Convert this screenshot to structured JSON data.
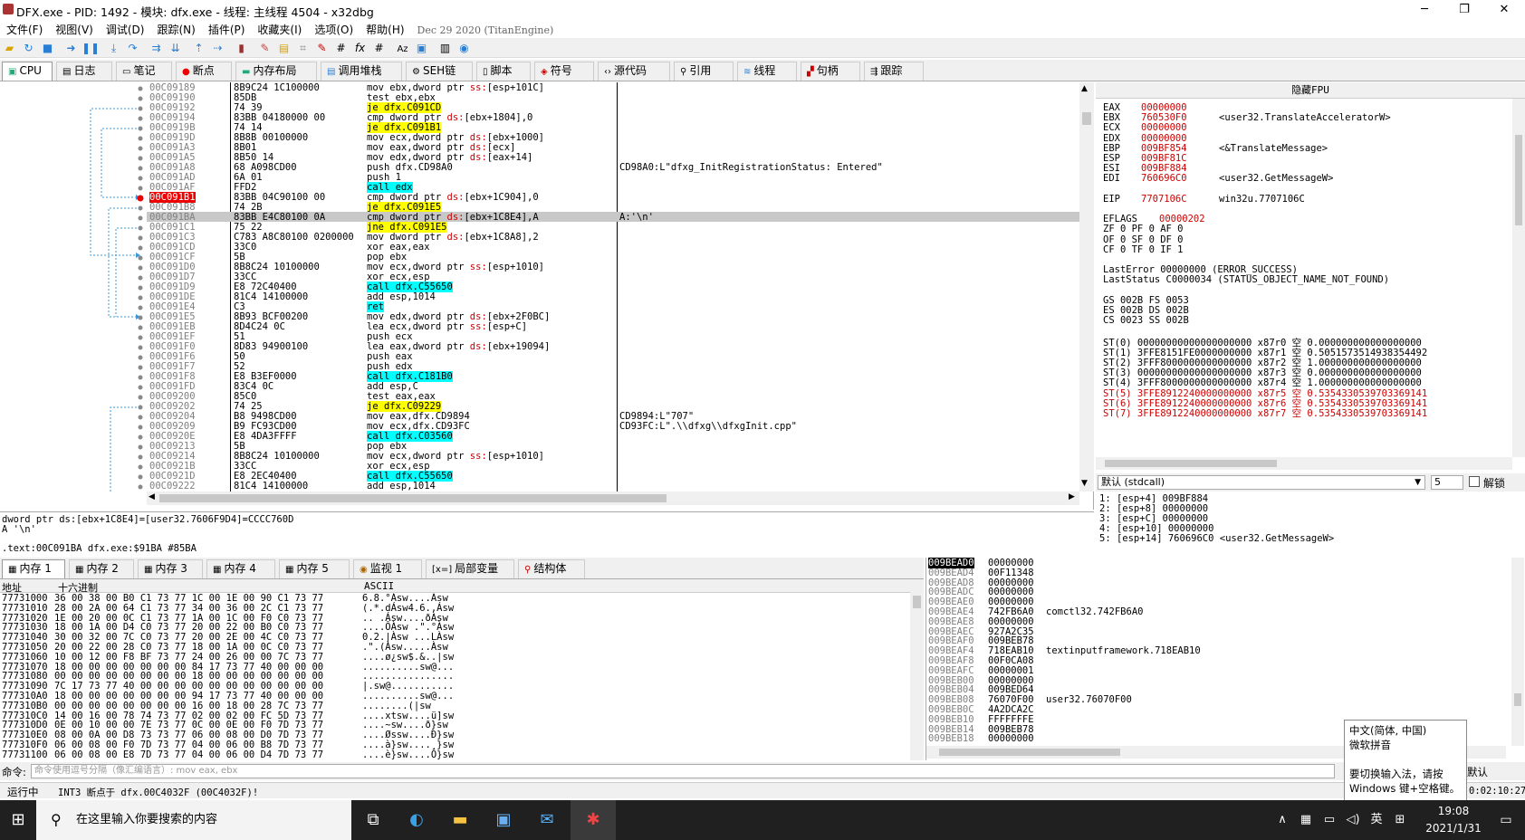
{
  "window": {
    "title": "DFX.exe - PID: 1492 - 模块: dfx.exe - 线程: 主线程 4504 - x32dbg",
    "minimize": "─",
    "restore": "❐",
    "close": "✕"
  },
  "menu": {
    "items": [
      "文件(F)",
      "视图(V)",
      "调试(D)",
      "跟踪(N)",
      "插件(P)",
      "收藏夹(I)",
      "选项(O)",
      "帮助(H)"
    ],
    "build": "Dec 29 2020 (TitanEngine)"
  },
  "tabs": [
    {
      "icon": "cpu-icon",
      "label": "CPU"
    },
    {
      "icon": "log-icon",
      "label": "日志"
    },
    {
      "icon": "notes-icon",
      "label": "笔记"
    },
    {
      "icon": "breakpoint-icon",
      "label": "断点"
    },
    {
      "icon": "memory-map-icon",
      "label": "内存布局"
    },
    {
      "icon": "callstack-icon",
      "label": "调用堆栈"
    },
    {
      "icon": "seh-icon",
      "label": "SEH链"
    },
    {
      "icon": "script-icon",
      "label": "脚本"
    },
    {
      "icon": "symbol-icon",
      "label": "符号"
    },
    {
      "icon": "source-icon",
      "label": "源代码"
    },
    {
      "icon": "references-icon",
      "label": "引用"
    },
    {
      "icon": "threads-icon",
      "label": "线程"
    },
    {
      "icon": "handles-icon",
      "label": "句柄"
    },
    {
      "icon": "trace-icon",
      "label": "跟踪"
    }
  ],
  "disasm": [
    {
      "addr": "00C09189",
      "bytes": "8B9C24 1C100000",
      "ins": "mov ebx,dword ptr ss:[esp+101C]",
      "cmt": ""
    },
    {
      "addr": "00C09190",
      "bytes": "85DB",
      "ins": "test ebx,ebx",
      "cmt": ""
    },
    {
      "addr": "00C09192",
      "bytes": "74 39",
      "ins": "je dfx.C091CD",
      "cmt": "",
      "kind": "jmp"
    },
    {
      "addr": "00C09194",
      "bytes": "83BB 04180000 00",
      "ins": "cmp dword ptr ds:[ebx+1804],0",
      "cmt": ""
    },
    {
      "addr": "00C0919B",
      "bytes": "74 14",
      "ins": "je dfx.C091B1",
      "cmt": "",
      "kind": "jmp"
    },
    {
      "addr": "00C0919D",
      "bytes": "8B8B 00100000",
      "ins": "mov ecx,dword ptr ds:[ebx+1000]",
      "cmt": ""
    },
    {
      "addr": "00C091A3",
      "bytes": "8B01",
      "ins": "mov eax,dword ptr ds:[ecx]",
      "cmt": ""
    },
    {
      "addr": "00C091A5",
      "bytes": "8B50 14",
      "ins": "mov edx,dword ptr ds:[eax+14]",
      "cmt": ""
    },
    {
      "addr": "00C091A8",
      "bytes": "68 A098CD00",
      "ins": "push dfx.CD98A0",
      "cmt": "CD98A0:L\"dfxg_InitRegistrationStatus: Entered\""
    },
    {
      "addr": "00C091AD",
      "bytes": "6A 01",
      "ins": "push 1",
      "cmt": ""
    },
    {
      "addr": "00C091AF",
      "bytes": "FFD2",
      "ins": "call edx",
      "cmt": "",
      "kind": "call"
    },
    {
      "addr": "00C091B1",
      "bytes": "83BB 04C90100 00",
      "ins": "cmp dword ptr ds:[ebx+1C904],0",
      "cmt": "",
      "kind": "eip"
    },
    {
      "addr": "00C091B8",
      "bytes": "74 2B",
      "ins": "je dfx.C091E5",
      "cmt": "",
      "kind": "jmp"
    },
    {
      "addr": "00C091BA",
      "bytes": "83BB E4C80100 0A",
      "ins": "cmp dword ptr ds:[ebx+1C8E4],A",
      "cmt": "A:'\\n'",
      "kind": "sel"
    },
    {
      "addr": "00C091C1",
      "bytes": "75 22",
      "ins": "jne dfx.C091E5",
      "cmt": "",
      "kind": "jmp"
    },
    {
      "addr": "00C091C3",
      "bytes": "C783 A8C80100 0200000",
      "ins": "mov dword ptr ds:[ebx+1C8A8],2",
      "cmt": ""
    },
    {
      "addr": "00C091CD",
      "bytes": "33C0",
      "ins": "xor eax,eax",
      "cmt": ""
    },
    {
      "addr": "00C091CF",
      "bytes": "5B",
      "ins": "pop ebx",
      "cmt": ""
    },
    {
      "addr": "00C091D0",
      "bytes": "8B8C24 10100000",
      "ins": "mov ecx,dword ptr ss:[esp+1010]",
      "cmt": ""
    },
    {
      "addr": "00C091D7",
      "bytes": "33CC",
      "ins": "xor ecx,esp",
      "cmt": ""
    },
    {
      "addr": "00C091D9",
      "bytes": "E8 72C40400",
      "ins": "call dfx.C55650",
      "cmt": "",
      "kind": "call"
    },
    {
      "addr": "00C091DE",
      "bytes": "81C4 14100000",
      "ins": "add esp,1014",
      "cmt": ""
    },
    {
      "addr": "00C091E4",
      "bytes": "C3",
      "ins": "ret",
      "cmt": "",
      "kind": "call"
    },
    {
      "addr": "00C091E5",
      "bytes": "8B93 BCF00200",
      "ins": "mov edx,dword ptr ds:[ebx+2F0BC]",
      "cmt": ""
    },
    {
      "addr": "00C091EB",
      "bytes": "8D4C24 0C",
      "ins": "lea ecx,dword ptr ss:[esp+C]",
      "cmt": ""
    },
    {
      "addr": "00C091EF",
      "bytes": "51",
      "ins": "push ecx",
      "cmt": ""
    },
    {
      "addr": "00C091F0",
      "bytes": "8D83 94900100",
      "ins": "lea eax,dword ptr ds:[ebx+19094]",
      "cmt": ""
    },
    {
      "addr": "00C091F6",
      "bytes": "50",
      "ins": "push eax",
      "cmt": ""
    },
    {
      "addr": "00C091F7",
      "bytes": "52",
      "ins": "push edx",
      "cmt": ""
    },
    {
      "addr": "00C091F8",
      "bytes": "E8 B3EF0000",
      "ins": "call dfx.C181B0",
      "cmt": "",
      "kind": "call"
    },
    {
      "addr": "00C091FD",
      "bytes": "83C4 0C",
      "ins": "add esp,C",
      "cmt": ""
    },
    {
      "addr": "00C09200",
      "bytes": "85C0",
      "ins": "test eax,eax",
      "cmt": ""
    },
    {
      "addr": "00C09202",
      "bytes": "74 25",
      "ins": "je dfx.C09229",
      "cmt": "",
      "kind": "jmp"
    },
    {
      "addr": "00C09204",
      "bytes": "B8 9498CD00",
      "ins": "mov eax,dfx.CD9894",
      "cmt": "CD9894:L\"707\""
    },
    {
      "addr": "00C09209",
      "bytes": "B9 FC93CD00",
      "ins": "mov ecx,dfx.CD93FC",
      "cmt": "CD93FC:L\".\\\\dfxg\\\\dfxgInit.cpp\""
    },
    {
      "addr": "00C0920E",
      "bytes": "E8 4DA3FFFF",
      "ins": "call dfx.C03560",
      "cmt": "",
      "kind": "call"
    },
    {
      "addr": "00C09213",
      "bytes": "5B",
      "ins": "pop ebx",
      "cmt": ""
    },
    {
      "addr": "00C09214",
      "bytes": "8B8C24 10100000",
      "ins": "mov ecx,dword ptr ss:[esp+1010]",
      "cmt": ""
    },
    {
      "addr": "00C0921B",
      "bytes": "33CC",
      "ins": "xor ecx,esp",
      "cmt": ""
    },
    {
      "addr": "00C0921D",
      "bytes": "E8 2EC40400",
      "ins": "call dfx.C55650",
      "cmt": "",
      "kind": "call"
    },
    {
      "addr": "00C09222",
      "bytes": "81C4 14100000",
      "ins": "add esp,1014",
      "cmt": ""
    }
  ],
  "info": {
    "line1": "dword ptr ds:[ebx+1C8E4]=[user32.7606F9D4]=CCCC760D",
    "line2": "A '\\n'",
    "line3": ".text:00C091BA dfx.exe:$91BA #85BA"
  },
  "regs": {
    "header": "隐藏FPU",
    "rows": [
      {
        "n": "EAX",
        "v": "00000000",
        "c": ""
      },
      {
        "n": "EBX",
        "v": "760530F0",
        "c": "<user32.TranslateAcceleratorW>"
      },
      {
        "n": "ECX",
        "v": "00000000",
        "c": ""
      },
      {
        "n": "EDX",
        "v": "00000000",
        "c": ""
      },
      {
        "n": "EBP",
        "v": "009BF854",
        "c": "<&TranslateMessage>"
      },
      {
        "n": "ESP",
        "v": "009BF81C",
        "c": ""
      },
      {
        "n": "ESI",
        "v": "009BF884",
        "c": ""
      },
      {
        "n": "EDI",
        "v": "760696C0",
        "c": "<user32.GetMessageW>"
      }
    ],
    "eip": {
      "n": "EIP",
      "v": "7707106C",
      "c": "win32u.7707106C"
    },
    "eflags": {
      "n": "EFLAGS",
      "v": "00000202"
    },
    "flags1": "ZF 0  PF 0  AF 0",
    "flags2": "OF 0  SF 0  DF 0",
    "flags3": "CF 0  TF 0  IF 1",
    "lasterror": "LastError  00000000 (ERROR_SUCCESS)",
    "laststatus": "LastStatus C0000034 (STATUS_OBJECT_NAME_NOT_FOUND)",
    "seg1": "GS 002B  FS 0053",
    "seg2": "ES 002B  DS 002B",
    "seg3": "CS 0023  SS 002B",
    "st": [
      "ST(0) 00000000000000000000 x87r0 空 0.000000000000000000",
      "ST(1) 3FFE8151FE0000000000 x87r1 空 0.5051573514938354492",
      "ST(2) 3FFF8000000000000000 x87r2 空 1.000000000000000000",
      "ST(3) 00000000000000000000 x87r3 空 0.000000000000000000",
      "ST(4) 3FFF8000000000000000 x87r4 空 1.000000000000000000",
      "ST(5) 3FFE8912240000000000 x87r5 空 0.5354330539703369141",
      "ST(6) 3FFE8912240000000000 x87r6 空 0.5354330539703369141",
      "ST(7) 3FFE8912240000000000 x87r7 空 0.5354330539703369141"
    ]
  },
  "callconv": {
    "value": "默认 (stdcall)",
    "count": "5",
    "unlock": "解锁"
  },
  "stackargs": [
    "1: [esp+4] 009BF884",
    "2: [esp+8] 00000000",
    "3: [esp+C] 00000000",
    "4: [esp+10] 00000000",
    "5: [esp+14] 760696C0 <user32.GetMessageW>"
  ],
  "memtabs": [
    "内存 1",
    "内存 2",
    "内存 3",
    "内存 4",
    "内存 5",
    "监视 1",
    "局部变量",
    "结构体"
  ],
  "dump": {
    "h_addr": "地址",
    "h_hex": "十六进制",
    "h_ascii": "ASCII",
    "rows": [
      {
        "a": "77731000",
        "h": "36 00 38 00 B0 C1 73 77 1C 00 1E 00 90 C1 73 77",
        "s": "6.8.°Ásw....Ásw"
      },
      {
        "a": "77731010",
        "h": "28 00 2A 00 64 C1 73 77 34 00 36 00 2C C1 73 77",
        "s": "(.*.dÁsw4.6.,Ásw"
      },
      {
        "a": "77731020",
        "h": "1E 00 20 00 0C C1 73 77 1A 00 1C 00 F0 C0 73 77",
        "s": ".. .Ásw....ðÀsw"
      },
      {
        "a": "77731030",
        "h": "18 00 1A 00 D4 C0 73 77 20 00 22 00 B0 C0 73 77",
        "s": "....ÔÀsw .\".°Àsw"
      },
      {
        "a": "77731040",
        "h": "30 00 32 00 7C C0 73 77 20 00 2E 00 4C C0 73 77",
        "s": "0.2.|Àsw ...LÀsw"
      },
      {
        "a": "77731050",
        "h": "20 00 22 00 28 C0 73 77 18 00 1A 00 0C C0 73 77",
        "s": " .\".(Àsw.....Àsw"
      },
      {
        "a": "77731060",
        "h": "10 00 12 00 F8 BF 73 77 24 00 26 00 00 7C 73 77",
        "s": "....ø¿sw$.&..|sw"
      },
      {
        "a": "77731070",
        "h": "18 00 00 00 00 00 00 00 84 17 73 77 40 00 00 00",
        "s": "..........sw@..."
      },
      {
        "a": "77731080",
        "h": "00 00 00 00 00 00 00 00 18 00 00 00 00 00 00 00",
        "s": "................"
      },
      {
        "a": "77731090",
        "h": "7C 17 73 77 40 00 00 00 00 00 00 00 00 00 00 00",
        "s": "|.sw@..........."
      },
      {
        "a": "777310A0",
        "h": "18 00 00 00 00 00 00 00 94 17 73 77 40 00 00 00",
        "s": "..........sw@..."
      },
      {
        "a": "777310B0",
        "h": "00 00 00 00 00 00 00 00 16 00 18 00 28 7C 73 77",
        "s": "........(|sw"
      },
      {
        "a": "777310C0",
        "h": "14 00 16 00 78 74 73 77 02 00 02 00 FC 5D 73 77",
        "s": "....xtsw....ü]sw"
      },
      {
        "a": "777310D0",
        "h": "0E 00 10 00 00 7E 73 77 0C 00 0E 00 F0 7D 73 77",
        "s": "....~sw....ð}sw"
      },
      {
        "a": "777310E0",
        "h": "08 00 0A 00 D8 73 73 77 06 00 08 00 D0 7D 73 77",
        "s": "....Øssw....Ð}sw"
      },
      {
        "a": "777310F0",
        "h": "06 00 08 00 F0 7D 73 77 04 00 06 00 B8 7D 73 77",
        "s": "....à}sw....¸}sw"
      },
      {
        "a": "77731100",
        "h": "06 00 08 00 E8 7D 73 77 04 00 06 00 D4 7D 73 77",
        "s": "....è}sw....Ô}sw"
      }
    ]
  },
  "stack": [
    {
      "a": "009BEAD0",
      "v": "00000000",
      "c": ""
    },
    {
      "a": "009BEAD4",
      "v": "00F11348",
      "c": ""
    },
    {
      "a": "009BEAD8",
      "v": "00000000",
      "c": ""
    },
    {
      "a": "009BEADC",
      "v": "00000000",
      "c": ""
    },
    {
      "a": "009BEAE0",
      "v": "00000000",
      "c": ""
    },
    {
      "a": "009BEAE4",
      "v": "742FB6A0",
      "c": "comctl32.742FB6A0"
    },
    {
      "a": "009BEAE8",
      "v": "00000000",
      "c": ""
    },
    {
      "a": "009BEAEC",
      "v": "927A2C35",
      "c": ""
    },
    {
      "a": "009BEAF0",
      "v": "009BEB78",
      "c": ""
    },
    {
      "a": "009BEAF4",
      "v": "718EAB10",
      "c": "textinputframework.718EAB10"
    },
    {
      "a": "009BEAF8",
      "v": "00F0CA08",
      "c": ""
    },
    {
      "a": "009BEAFC",
      "v": "00000001",
      "c": ""
    },
    {
      "a": "009BEB00",
      "v": "00000000",
      "c": ""
    },
    {
      "a": "009BEB04",
      "v": "009BED64",
      "c": ""
    },
    {
      "a": "009BEB08",
      "v": "76070F00",
      "c": "user32.76070F00"
    },
    {
      "a": "009BEB0C",
      "v": "4A2DCA2C",
      "c": ""
    },
    {
      "a": "009BEB10",
      "v": "FFFFFFFE",
      "c": ""
    },
    {
      "a": "009BEB14",
      "v": "009BEB78",
      "c": ""
    },
    {
      "a": "009BEB18",
      "v": "00000000",
      "c": ""
    }
  ],
  "cmd": {
    "label": "命令:",
    "placeholder": "命令使用逗号分隔（像汇编语言）: mov eax, ebx",
    "mode": "默认"
  },
  "status": {
    "state": "运行中",
    "msg": "INT3 断点于 dfx.00C4032F (00C4032F)!",
    "time": "0:02:10:27"
  },
  "ime": {
    "lang": "中文(简体, 中国)",
    "name": "微软拼音",
    "hint": "要切换输入法，请按 Windows 键+空格键。"
  },
  "taskbar": {
    "search": "在这里输入你要搜索的内容",
    "time": "19:08",
    "date": "2021/1/31",
    "lang": "英"
  }
}
